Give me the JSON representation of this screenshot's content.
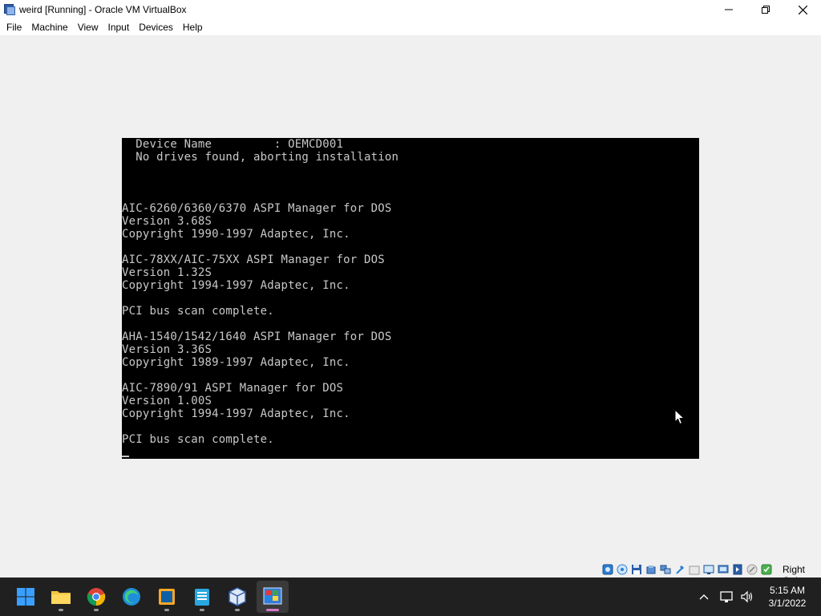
{
  "window": {
    "title": "weird [Running] - Oracle VM VirtualBox"
  },
  "menu": [
    "File",
    "Machine",
    "View",
    "Input",
    "Devices",
    "Help"
  ],
  "console": {
    "lines": [
      "  Device Name         : OEMCD001",
      "  No drives found, aborting installation",
      "",
      "",
      "",
      "AIC-6260/6360/6370 ASPI Manager for DOS",
      "Version 3.68S",
      "Copyright 1990-1997 Adaptec, Inc.",
      "",
      "AIC-78XX/AIC-75XX ASPI Manager for DOS",
      "Version 1.32S",
      "Copyright 1994-1997 Adaptec, Inc.",
      "",
      "PCI bus scan complete.",
      "",
      "AHA-1540/1542/1640 ASPI Manager for DOS",
      "Version 3.36S",
      "Copyright 1989-1997 Adaptec, Inc.",
      "",
      "AIC-7890/91 ASPI Manager for DOS",
      "Version 1.00S",
      "Copyright 1994-1997 Adaptec, Inc.",
      "",
      "PCI bus scan complete."
    ]
  },
  "statusbar": {
    "icons": [
      "hard-disk-icon",
      "optical-drive-icon",
      "floppy-icon",
      "audio-icon",
      "network-icon",
      "usb-icon",
      "shared-folders-icon",
      "display-icon",
      "video-capture-icon",
      "recording-icon",
      "mouse-integration-icon",
      "vm-status-icon"
    ],
    "host_key": "Right Ctrl"
  },
  "taskbar": {
    "apps": [
      "start-icon",
      "file-explorer-icon",
      "chrome-icon",
      "edge-icon",
      "photo-app-icon",
      "notepad-icon",
      "virtualbox-icon",
      "vm-winxp-icon"
    ],
    "tray_icons": [
      "show-hidden-icons-chevron-icon",
      "network-icon",
      "volume-icon"
    ],
    "clock": {
      "time": "5:15 AM",
      "date": "3/1/2022"
    }
  }
}
